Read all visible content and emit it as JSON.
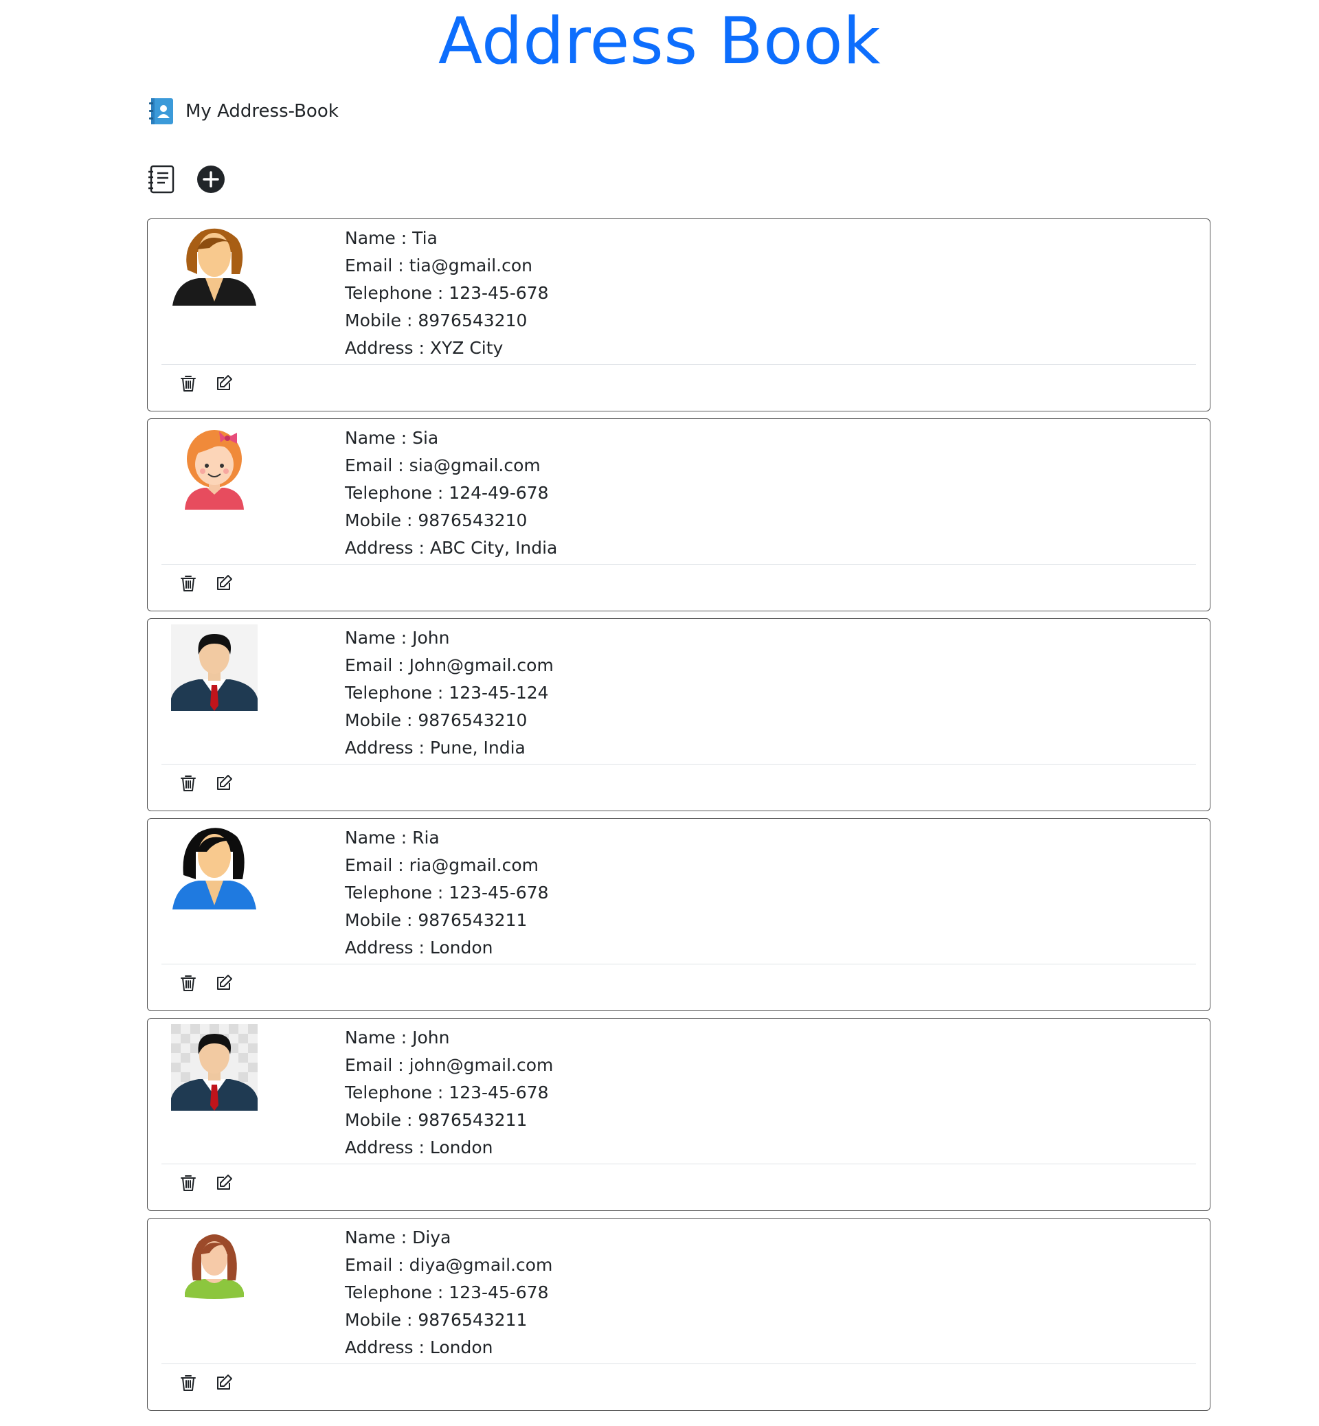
{
  "page": {
    "title": "Address Book",
    "brand": "My Address-Book",
    "accent_color": "#0d6efd"
  },
  "toolbar": {
    "list_icon": "list-icon",
    "add_icon": "plus-circle-icon"
  },
  "contacts": [
    {
      "name": "Name : Tia",
      "email": "Email : tia@gmail.con",
      "telephone": "Telephone : 123-45-678",
      "mobile": "Mobile : 8976543210",
      "address": "Address : XYZ City",
      "avatar": "woman-brown-hair-avatar"
    },
    {
      "name": "Name : Sia",
      "email": "Email : sia@gmail.com",
      "telephone": "Telephone : 124-49-678",
      "mobile": "Mobile : 9876543210",
      "address": "Address : ABC City, India",
      "avatar": "girl-orange-hair-avatar"
    },
    {
      "name": "Name : John",
      "email": "Email : John@gmail.com",
      "telephone": "Telephone : 123-45-124",
      "mobile": "Mobile : 9876543210",
      "address": "Address : Pune, India",
      "avatar": "man-suit-avatar"
    },
    {
      "name": "Name : Ria",
      "email": "Email : ria@gmail.com",
      "telephone": "Telephone : 123-45-678",
      "mobile": "Mobile : 9876543211",
      "address": "Address : London",
      "avatar": "woman-black-hair-avatar"
    },
    {
      "name": "Name : John",
      "email": "Email : john@gmail.com",
      "telephone": "Telephone : 123-45-678",
      "mobile": "Mobile : 9876543211",
      "address": "Address : London",
      "avatar": "man-suit-avatar"
    },
    {
      "name": "Name : Diya",
      "email": "Email : diya@gmail.com",
      "telephone": "Telephone : 123-45-678",
      "mobile": "Mobile : 9876543211",
      "address": "Address : London",
      "avatar": "woman-green-top-avatar"
    }
  ],
  "actions": {
    "delete_icon": "trash-icon",
    "edit_icon": "edit-icon"
  }
}
